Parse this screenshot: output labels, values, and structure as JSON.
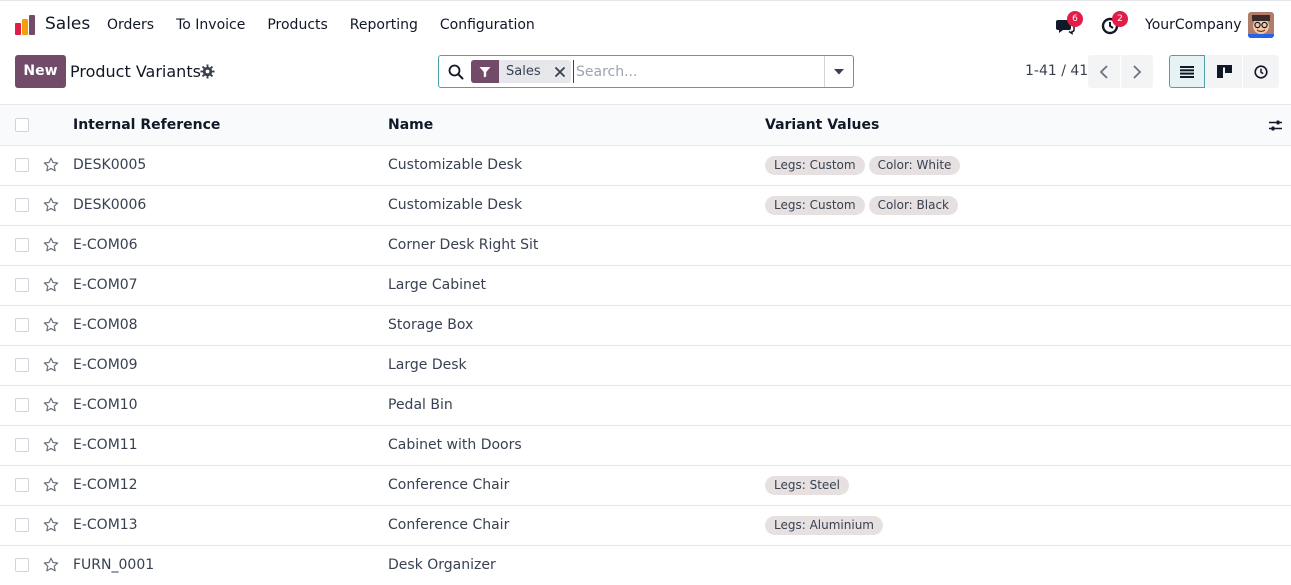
{
  "navbar": {
    "app_name": "Sales",
    "menu": [
      "Orders",
      "To Invoice",
      "Products",
      "Reporting",
      "Configuration"
    ],
    "messages_badge": "6",
    "activities_badge": "2",
    "company": "YourCompany"
  },
  "control_panel": {
    "new_label": "New",
    "title": "Product Variants",
    "search": {
      "facet_label": "Sales",
      "placeholder": "Search..."
    },
    "pager": "1-41 / 41"
  },
  "table": {
    "columns": [
      "Internal Reference",
      "Name",
      "Variant Values"
    ],
    "rows": [
      {
        "ref": "DESK0005",
        "name": "Customizable Desk",
        "values": [
          "Legs: Custom",
          "Color: White"
        ]
      },
      {
        "ref": "DESK0006",
        "name": "Customizable Desk",
        "values": [
          "Legs: Custom",
          "Color: Black"
        ]
      },
      {
        "ref": "E-COM06",
        "name": "Corner Desk Right Sit",
        "values": []
      },
      {
        "ref": "E-COM07",
        "name": "Large Cabinet",
        "values": []
      },
      {
        "ref": "E-COM08",
        "name": "Storage Box",
        "values": []
      },
      {
        "ref": "E-COM09",
        "name": "Large Desk",
        "values": []
      },
      {
        "ref": "E-COM10",
        "name": "Pedal Bin",
        "values": []
      },
      {
        "ref": "E-COM11",
        "name": "Cabinet with Doors",
        "values": []
      },
      {
        "ref": "E-COM12",
        "name": "Conference Chair",
        "values": [
          "Legs: Steel"
        ]
      },
      {
        "ref": "E-COM13",
        "name": "Conference Chair",
        "values": [
          "Legs: Aluminium"
        ]
      },
      {
        "ref": "FURN_0001",
        "name": "Desk Organizer",
        "values": []
      }
    ]
  },
  "colors": {
    "brand": "#714b67",
    "accent": "#4aa4a7",
    "badge": "#e11d48",
    "tag_bg": "#e7e0e0"
  },
  "icons": {
    "app": "sales-app-icon",
    "title_gear": "gear-icon",
    "search": "search-icon",
    "facet": "filter-icon",
    "facet_remove": "close-icon",
    "search_toggle": "caret-down-icon",
    "pager_prev": "chevron-left-icon",
    "pager_next": "chevron-right-icon",
    "view_list": "list-view-icon",
    "view_kanban": "kanban-view-icon",
    "view_activity": "clock-icon",
    "messages": "chat-icon",
    "activities": "activity-clock-icon",
    "row_favorite": "star-icon",
    "optional_columns": "sliders-icon"
  }
}
